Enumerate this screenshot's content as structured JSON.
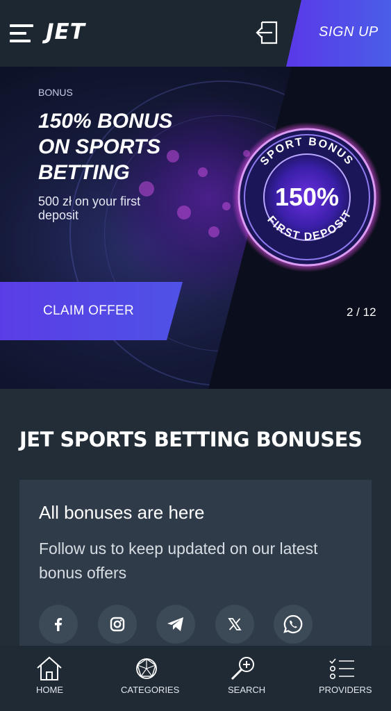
{
  "header": {
    "logo": "JET",
    "signup_label": "SIGN UP"
  },
  "banner": {
    "tag": "BONUS",
    "title_lines": [
      "150% BONUS",
      "ON SPORTS",
      "BETTING"
    ],
    "subtitle_lines": [
      "500 zł on your first",
      "deposit"
    ],
    "claim_label": "CLAIM OFFER",
    "pager": "2 / 12",
    "medal": {
      "top_text": "SPORT BONUS",
      "center_text": "150%",
      "bottom_text": "FIRST DEPOSIT"
    }
  },
  "section": {
    "title": "JET SPORTS BETTING BONUSES"
  },
  "card": {
    "title": "All bonuses are here",
    "text": "Follow us to keep updated on our latest bonus offers",
    "social": [
      {
        "icon": "facebook-icon"
      },
      {
        "icon": "instagram-icon"
      },
      {
        "icon": "telegram-icon"
      },
      {
        "icon": "x-icon"
      },
      {
        "icon": "whatsapp-icon"
      }
    ]
  },
  "bottom_nav": {
    "items": [
      {
        "label": "HOME",
        "icon": "home-icon"
      },
      {
        "label": "CATEGORIES",
        "icon": "categories-icon"
      },
      {
        "label": "SEARCH",
        "icon": "search-icon"
      },
      {
        "label": "PROVIDERS",
        "icon": "providers-icon"
      }
    ]
  },
  "colors": {
    "accent": "#5a3de6",
    "header_bg": "#1d2731",
    "page_bg": "#222d38",
    "card_bg": "#2f3b48",
    "medal_glow": "#d14bd8"
  }
}
